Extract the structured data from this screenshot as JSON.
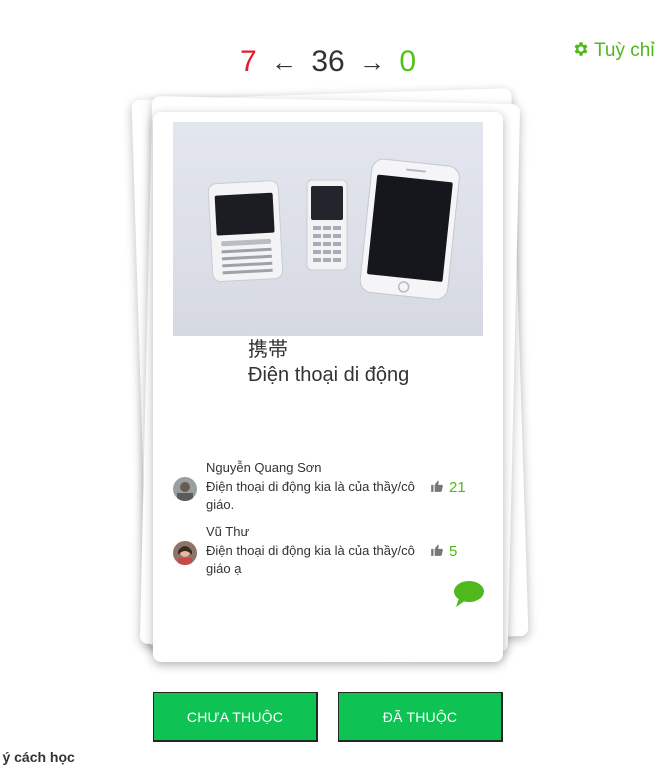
{
  "counter": {
    "left": "7",
    "left_arrow": "←",
    "total": "36",
    "right_arrow": "→",
    "right": "0"
  },
  "settings": {
    "icon": "gear-icon",
    "label": "Tuỳ chỉ"
  },
  "card": {
    "image": "three-mobile-phones-photo",
    "kanji": "携帯",
    "meaning": "Điện thoại di động",
    "comments": [
      {
        "author": "Nguyễn Quang Sơn",
        "text": "Điện thoại di động kia là của thầy/cô giáo.",
        "likes": "21"
      },
      {
        "author": "Vũ Thư",
        "text": "Điện thoại di động kia là của thầy/cô giáo ạ",
        "likes": "5"
      }
    ],
    "chat_icon": "speech-bubble-icon"
  },
  "buttons": {
    "not_learned": "CHƯA THUỘC",
    "learned": "ĐÃ THUỘC"
  },
  "footer": {
    "text": "p ý cách học"
  },
  "colors": {
    "accent_green": "#4fb81c",
    "button_green": "#0ec254",
    "counter_red": "#e8192c"
  }
}
